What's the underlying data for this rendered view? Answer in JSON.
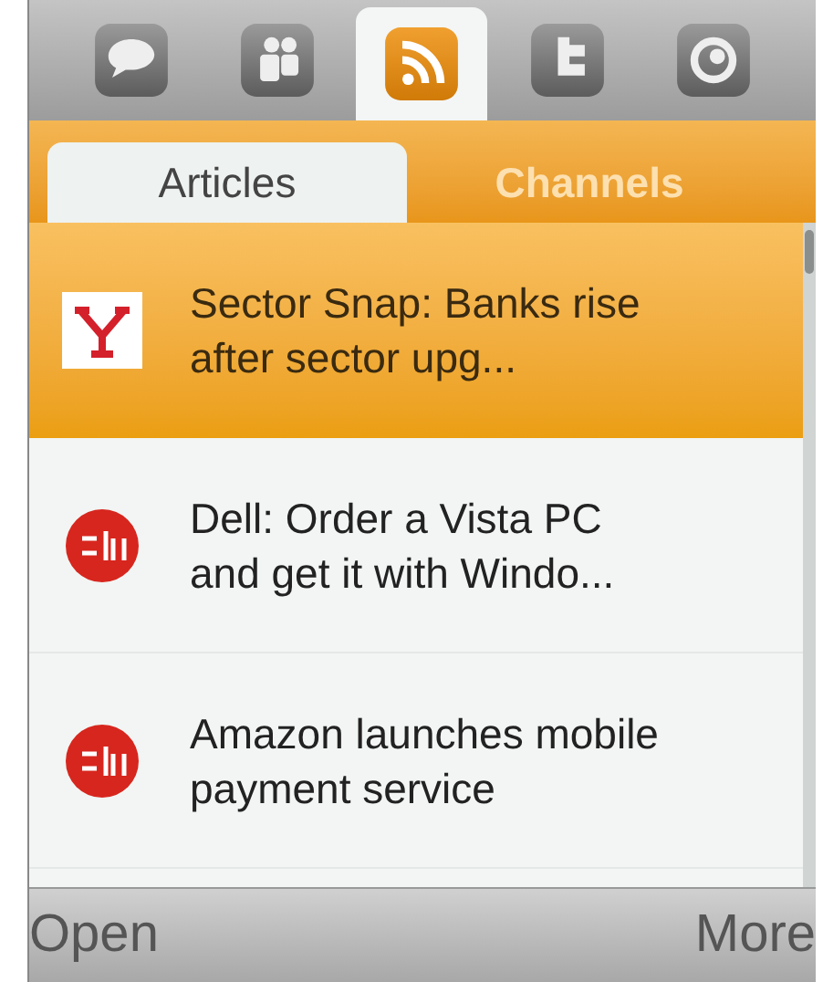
{
  "app_bar": {
    "icons": [
      {
        "kind": "chat",
        "selected": false
      },
      {
        "kind": "people",
        "selected": false
      },
      {
        "kind": "feed",
        "selected": true
      },
      {
        "kind": "letter",
        "selected": false
      },
      {
        "kind": "ring",
        "selected": false
      }
    ]
  },
  "tabs": [
    {
      "label": "Articles",
      "selected": true
    },
    {
      "label": "Channels",
      "selected": false
    }
  ],
  "articles": [
    {
      "title": "Sector Snap: Banks rise after sector upg...",
      "kind": "square-logo",
      "selected": true
    },
    {
      "title": "Dell: Order a Vista PC and get it with Windo...",
      "kind": "round-logo",
      "selected": false
    },
    {
      "title": "Amazon launches mobile payment service",
      "kind": "round-logo",
      "selected": false
    }
  ],
  "softkeys": {
    "left": "Open",
    "right": "More"
  }
}
